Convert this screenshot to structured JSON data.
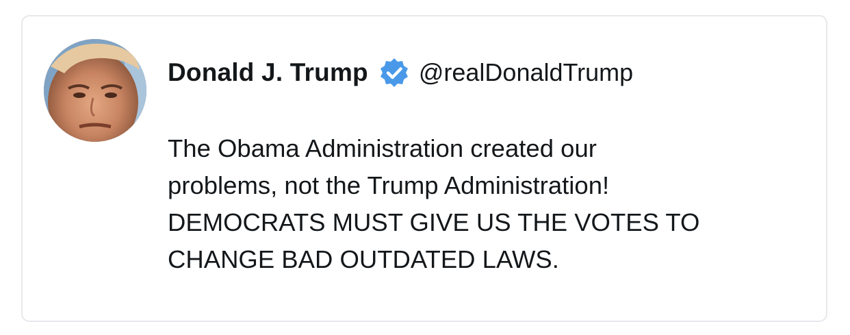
{
  "tweet": {
    "author": {
      "display_name": "Donald J. Trump",
      "handle": "@realDonaldTrump",
      "verified": true,
      "verified_icon": "verified-badge-icon",
      "verified_color": "#4a99e9"
    },
    "text_lines": [
      "The Obama Administration created our",
      "problems, not the Trump Administration!",
      "DEMOCRATS MUST GIVE US THE VOTES TO",
      "CHANGE BAD OUTDATED LAWS."
    ]
  },
  "colors": {
    "text": "#14171a",
    "card_border": "#e6e8eb",
    "background": "#ffffff"
  }
}
